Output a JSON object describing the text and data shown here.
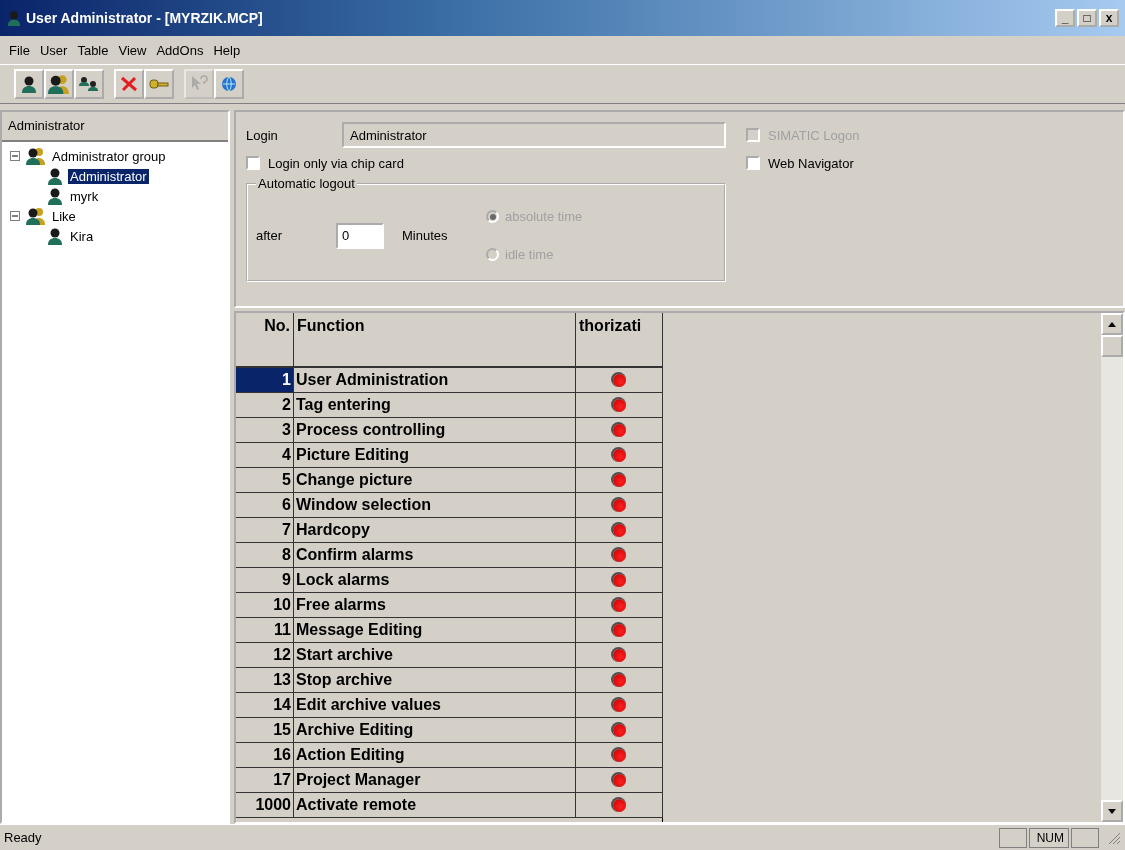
{
  "window": {
    "title": "User Administrator - [MYRZIK.MCP]",
    "controls": [
      "_",
      "□",
      "x"
    ]
  },
  "menu": [
    "File",
    "User",
    "Table",
    "View",
    "AddOns",
    "Help"
  ],
  "toolbar": [
    {
      "kind": "user",
      "disabled": false
    },
    {
      "kind": "group",
      "disabled": false
    },
    {
      "kind": "users",
      "disabled": false
    },
    {
      "kind": "delete",
      "disabled": false
    },
    {
      "kind": "key",
      "disabled": false
    },
    {
      "kind": "help",
      "disabled": true
    },
    {
      "kind": "web",
      "disabled": false
    }
  ],
  "sidebar": {
    "header": "Administrator",
    "tree": [
      {
        "label": "Administrator group",
        "kind": "group",
        "expanded": true,
        "selected": false,
        "children": [
          {
            "label": "Administrator",
            "kind": "user",
            "selected": true
          },
          {
            "label": "myrk",
            "kind": "user",
            "selected": false
          }
        ]
      },
      {
        "label": "Like",
        "kind": "group",
        "expanded": true,
        "selected": false,
        "children": [
          {
            "label": "Kira",
            "kind": "user",
            "selected": false
          }
        ]
      }
    ]
  },
  "form": {
    "login_label": "Login",
    "login_value": "Administrator",
    "chip_card": {
      "label": "Login only via chip card",
      "checked": false,
      "disabled": false
    },
    "simatic": {
      "label": "SIMATIC Logon",
      "checked": false,
      "disabled": true
    },
    "web": {
      "label": "Web Navigator",
      "checked": false,
      "disabled": false
    },
    "logout": {
      "title": "Automatic logout",
      "after": "after",
      "value": "0",
      "unit": "Minutes",
      "options": [
        {
          "label": "absolute time",
          "selected": true,
          "disabled": true
        },
        {
          "label": "idle time",
          "selected": false,
          "disabled": true
        }
      ]
    }
  },
  "table": {
    "columns": [
      "No.",
      "Function",
      "thorizati"
    ],
    "rows": [
      {
        "no": "1",
        "function": "User Administration",
        "authorized": true,
        "selected": true
      },
      {
        "no": "2",
        "function": "Tag entering",
        "authorized": true,
        "selected": false
      },
      {
        "no": "3",
        "function": "Process controlling",
        "authorized": true,
        "selected": false
      },
      {
        "no": "4",
        "function": "Picture Editing",
        "authorized": true,
        "selected": false
      },
      {
        "no": "5",
        "function": "Change picture",
        "authorized": true,
        "selected": false
      },
      {
        "no": "6",
        "function": "Window selection",
        "authorized": true,
        "selected": false
      },
      {
        "no": "7",
        "function": "Hardcopy",
        "authorized": true,
        "selected": false
      },
      {
        "no": "8",
        "function": "Confirm alarms",
        "authorized": true,
        "selected": false
      },
      {
        "no": "9",
        "function": "Lock alarms",
        "authorized": true,
        "selected": false
      },
      {
        "no": "10",
        "function": "Free alarms",
        "authorized": true,
        "selected": false
      },
      {
        "no": "11",
        "function": "Message Editing",
        "authorized": true,
        "selected": false
      },
      {
        "no": "12",
        "function": "Start archive",
        "authorized": true,
        "selected": false
      },
      {
        "no": "13",
        "function": "Stop archive",
        "authorized": true,
        "selected": false
      },
      {
        "no": "14",
        "function": "Edit archive values",
        "authorized": true,
        "selected": false
      },
      {
        "no": "15",
        "function": "Archive Editing",
        "authorized": true,
        "selected": false
      },
      {
        "no": "16",
        "function": "Action Editing",
        "authorized": true,
        "selected": false
      },
      {
        "no": "17",
        "function": "Project Manager",
        "authorized": true,
        "selected": false
      },
      {
        "no": "1000",
        "function": "Activate remote",
        "authorized": true,
        "selected": false
      }
    ]
  },
  "status_bar": {
    "text": "Ready",
    "indicators": [
      "NUM"
    ]
  }
}
